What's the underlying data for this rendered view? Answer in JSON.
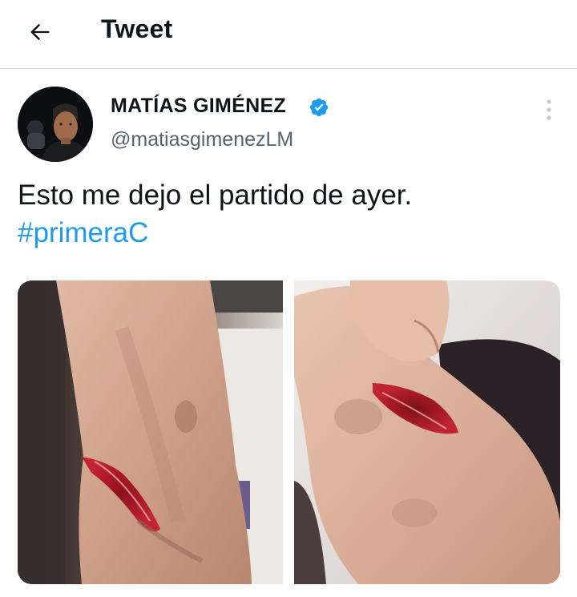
{
  "header": {
    "title": "Tweet",
    "back_icon": "arrow-left-icon"
  },
  "author": {
    "name": "MATÍAS GIMÉNEZ",
    "handle": "@matiasgimenezLM",
    "verified": true,
    "verified_color": "#1d9bf0"
  },
  "tweet": {
    "text": "Esto me dejo el partido de ayer.",
    "hashtag": "#primeraC"
  },
  "media": [
    {
      "name": "photo-1"
    },
    {
      "name": "photo-2"
    }
  ],
  "colors": {
    "accent": "#1d9bf0",
    "text": "#0f1419",
    "secondary_text": "#536471",
    "divider": "#e6e6e6"
  }
}
